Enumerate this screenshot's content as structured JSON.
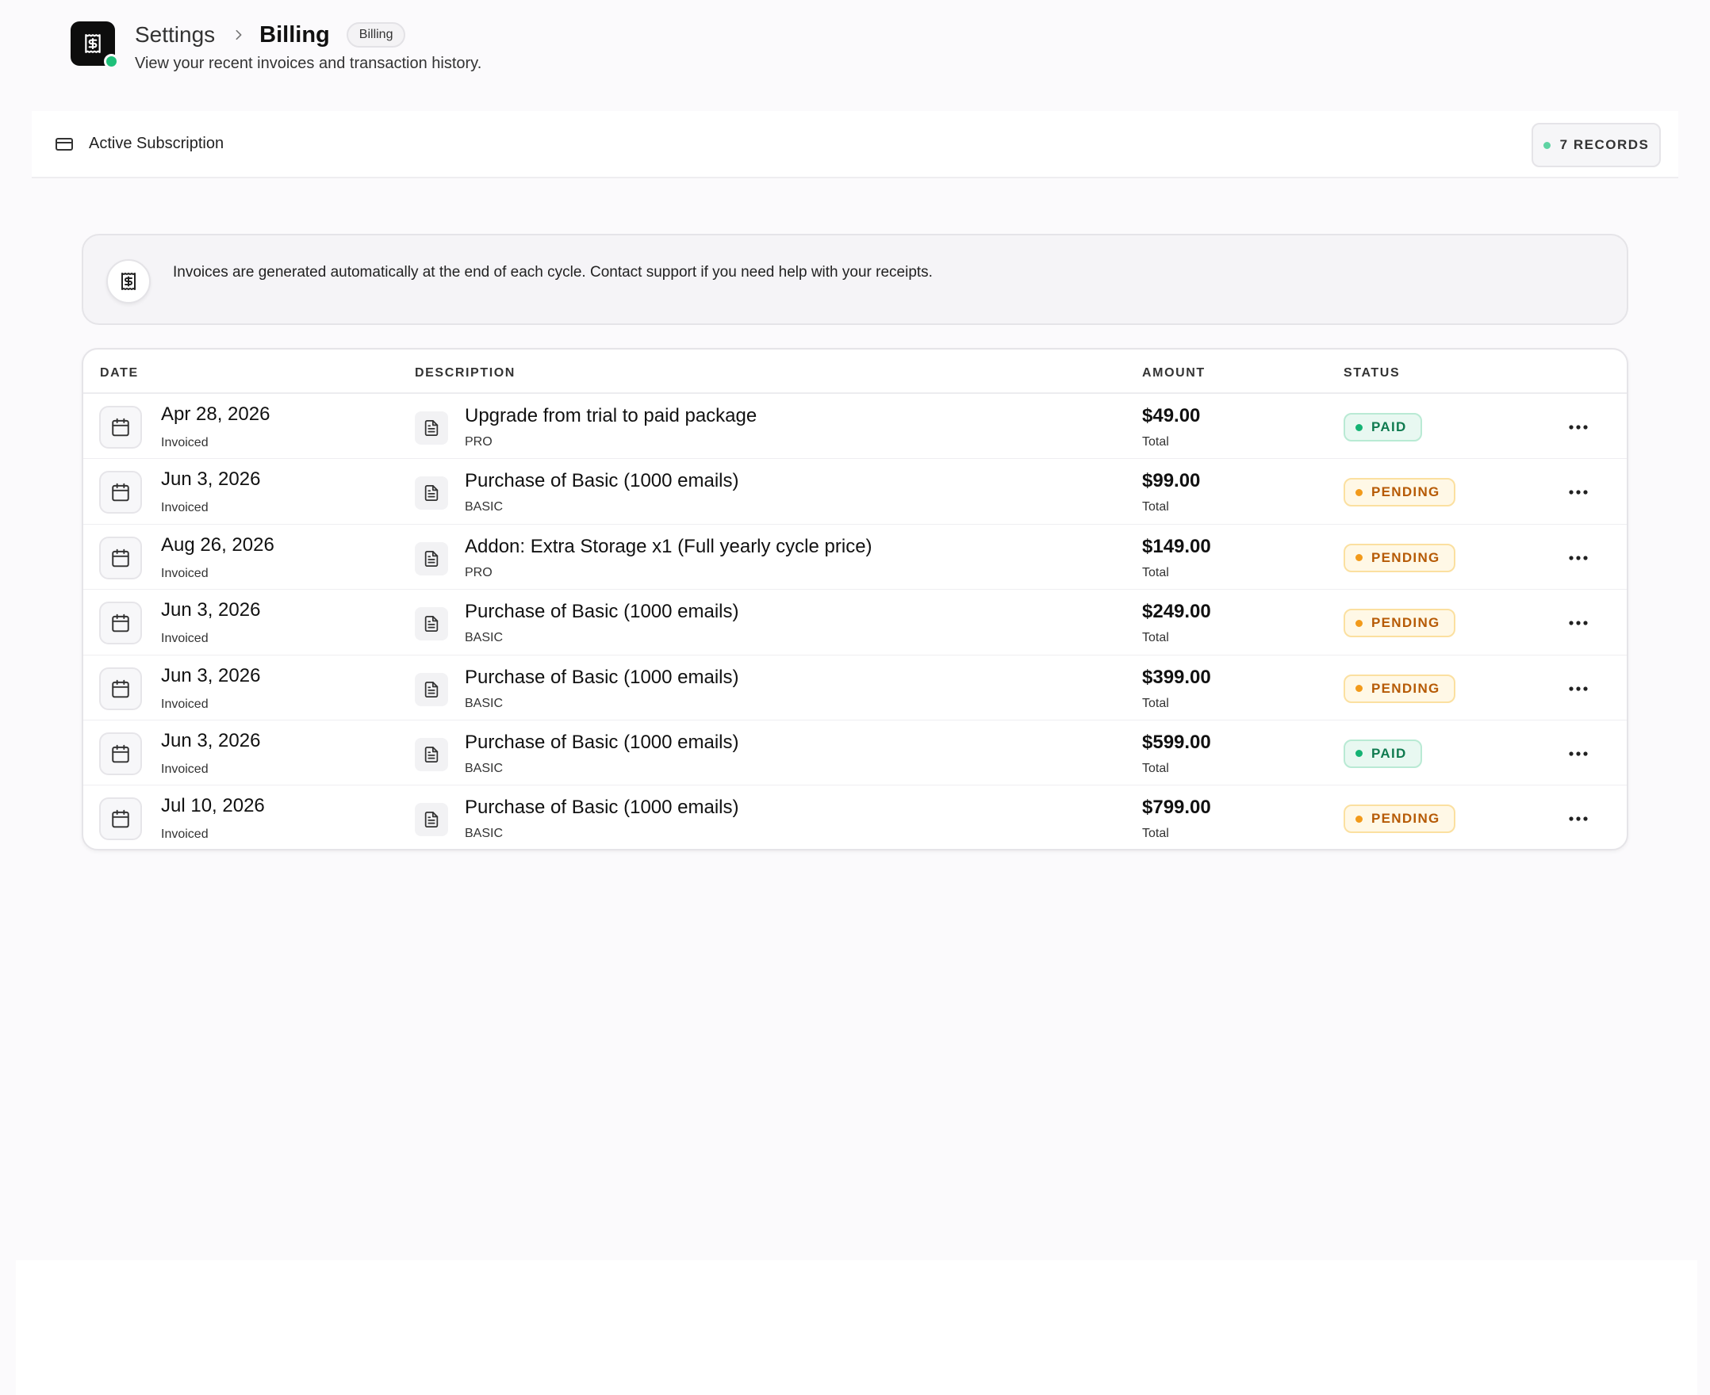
{
  "header": {
    "breadcrumb_parent": "Settings",
    "breadcrumb_current": "Billing",
    "badge": "Billing",
    "subtitle": "View your recent invoices and transaction history.",
    "status_color": "#1fc07a"
  },
  "subbar": {
    "label": "Active Subscription",
    "records": "7 RECORDS"
  },
  "notice": {
    "text": "Invoices are generated automatically at the end of each cycle. Contact support if you need help with your receipts."
  },
  "table": {
    "columns": [
      "DATE",
      "DESCRIPTION",
      "AMOUNT",
      "STATUS"
    ],
    "rows": [
      {
        "date": "Apr 28, 2026",
        "date_sub": "Invoiced",
        "desc": "Upgrade from trial to paid package",
        "plan": "PRO",
        "amount": "$49.00",
        "amount_sub": "Total",
        "status": "PAID"
      },
      {
        "date": "Jun 3, 2026",
        "date_sub": "Invoiced",
        "desc": "Purchase of Basic (1000 emails)",
        "plan": "BASIC",
        "amount": "$99.00",
        "amount_sub": "Total",
        "status": "PENDING"
      },
      {
        "date": "Aug 26, 2026",
        "date_sub": "Invoiced",
        "desc": "Addon: Extra Storage x1 (Full yearly cycle price)",
        "plan": "PRO",
        "amount": "$149.00",
        "amount_sub": "Total",
        "status": "PENDING"
      },
      {
        "date": "Jun 3, 2026",
        "date_sub": "Invoiced",
        "desc": "Purchase of Basic (1000 emails)",
        "plan": "BASIC",
        "amount": "$249.00",
        "amount_sub": "Total",
        "status": "PENDING"
      },
      {
        "date": "Jun 3, 2026",
        "date_sub": "Invoiced",
        "desc": "Purchase of Basic (1000 emails)",
        "plan": "BASIC",
        "amount": "$399.00",
        "amount_sub": "Total",
        "status": "PENDING"
      },
      {
        "date": "Jun 3, 2026",
        "date_sub": "Invoiced",
        "desc": "Purchase of Basic (1000 emails)",
        "plan": "BASIC",
        "amount": "$599.00",
        "amount_sub": "Total",
        "status": "PAID"
      },
      {
        "date": "Jul 10, 2026",
        "date_sub": "Invoiced",
        "desc": "Purchase of Basic (1000 emails)",
        "plan": "BASIC",
        "amount": "$799.00",
        "amount_sub": "Total",
        "status": "PENDING"
      }
    ]
  },
  "icons": {
    "app": "receipt-dollar-icon",
    "breadcrumb_separator": "chevron-right-icon",
    "subscription": "credit-card-icon",
    "notice": "receipt-dollar-icon",
    "date": "calendar-icon",
    "description": "document-icon",
    "actions": "more-horizontal-icon"
  }
}
